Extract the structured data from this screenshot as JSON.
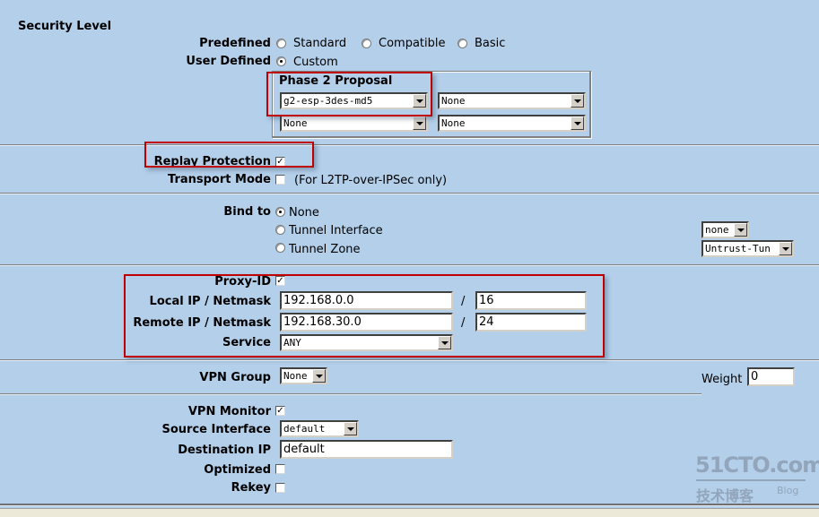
{
  "section_title": "Security Level",
  "predefined": {
    "label": "Predefined",
    "options": [
      {
        "label": "Standard",
        "selected": false
      },
      {
        "label": "Compatible",
        "selected": false
      },
      {
        "label": "Basic",
        "selected": false
      }
    ]
  },
  "user_defined": {
    "label": "User Defined",
    "option": {
      "label": "Custom",
      "selected": true
    }
  },
  "phase2": {
    "title": "Phase 2 Proposal",
    "selects": [
      "g2-esp-3des-md5",
      "None",
      "None",
      "None"
    ]
  },
  "replay_protection": {
    "label": "Replay Protection",
    "checked": true
  },
  "transport_mode": {
    "label": "Transport Mode",
    "checked": false,
    "note": "(For L2TP-over-IPSec only)"
  },
  "bind_to": {
    "label": "Bind to",
    "options": [
      {
        "label": "None",
        "selected": true
      },
      {
        "label": "Tunnel Interface",
        "selected": false
      },
      {
        "label": "Tunnel Zone",
        "selected": false
      }
    ],
    "tunnel_interface_value": "none",
    "tunnel_zone_value": "Untrust-Tun"
  },
  "proxy_id": {
    "label": "Proxy-ID",
    "checked": true,
    "local_label": "Local IP / Netmask",
    "local_ip": "192.168.0.0",
    "local_mask": "16",
    "remote_label": "Remote IP / Netmask",
    "remote_ip": "192.168.30.0",
    "remote_mask": "24",
    "slash": "/",
    "service_label": "Service",
    "service_value": "ANY"
  },
  "vpn_group": {
    "label": "VPN Group",
    "value": "None",
    "weight_label": "Weight",
    "weight_value": "0"
  },
  "vpn_monitor": {
    "label": "VPN Monitor",
    "checked": true,
    "source_interface_label": "Source Interface",
    "source_interface_value": "default",
    "destination_ip_label": "Destination IP",
    "destination_ip_value": "default",
    "optimized_label": "Optimized",
    "optimized_checked": false,
    "rekey_label": "Rekey",
    "rekey_checked": false
  },
  "watermark": {
    "site": "51CTO.com",
    "sub": "技术博客",
    "blog": "Blog"
  }
}
